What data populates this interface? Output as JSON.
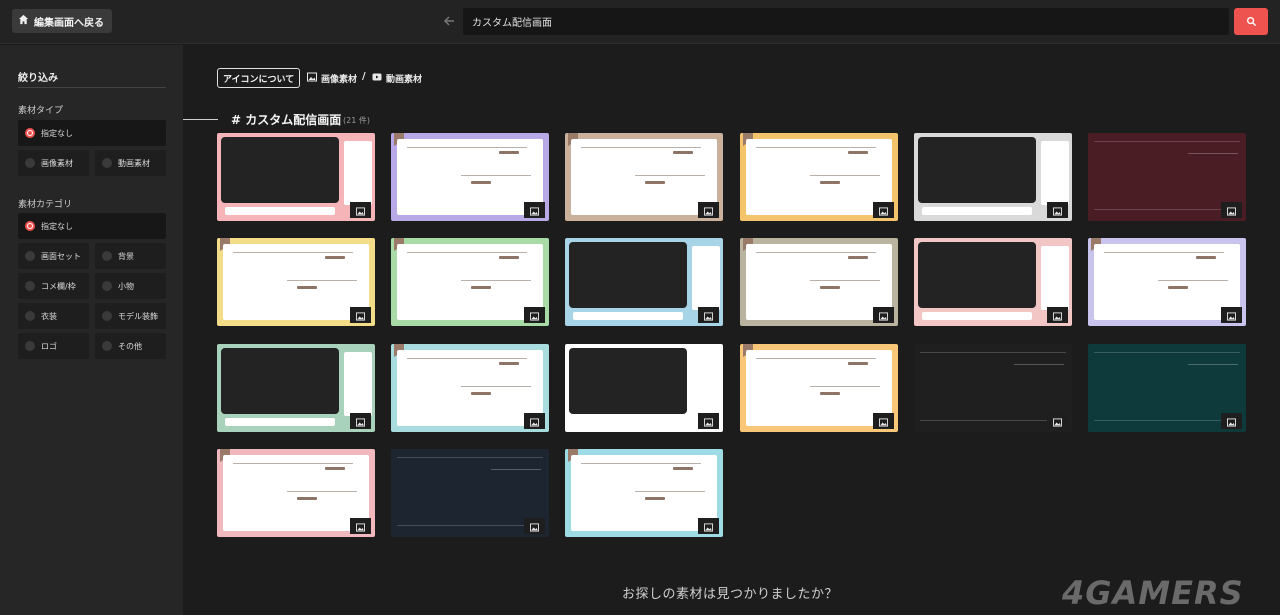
{
  "header": {
    "back_label": "編集画面へ戻る",
    "search_value": "カスタム配信画面",
    "icons": [
      "home-icon",
      "arrow-left-icon",
      "search-icon"
    ],
    "accent": "#ef5350"
  },
  "sidebar": {
    "title": "絞り込み",
    "material_type": {
      "label": "素材タイプ",
      "options": [
        "指定なし",
        "画像素材",
        "動画素材"
      ],
      "selected": "指定なし"
    },
    "material_category": {
      "label": "素材カテゴリ",
      "options": [
        "指定なし",
        "画面セット",
        "背景",
        "コメ欄/枠",
        "小物",
        "衣装",
        "モデル装飾",
        "ロゴ",
        "その他"
      ],
      "selected": "指定なし"
    }
  },
  "main": {
    "about_icons": "アイコンについて",
    "legend_image": "画像素材",
    "legend_sep": "/",
    "legend_video": "動画素材",
    "section_title": "# カスタム配信画面",
    "section_count": "(21 件)",
    "footer_question": "お探しの素材は見つかりましたか？"
  },
  "watermark": "4GAMERS",
  "thumbnails": [
    {
      "bg": "#f4b4b8",
      "kind": "screen"
    },
    {
      "bg": "#b9a8e6",
      "kind": "white"
    },
    {
      "bg": "#c9b19b",
      "kind": "white"
    },
    {
      "bg": "#f3c46c",
      "kind": "white"
    },
    {
      "bg": "#d9d9d9",
      "kind": "screen"
    },
    {
      "bg": "#4a1c24",
      "kind": "dark"
    },
    {
      "bg": "#f4dd88",
      "kind": "white"
    },
    {
      "bg": "#a8dba5",
      "kind": "white"
    },
    {
      "bg": "#a7d4e6",
      "kind": "screen"
    },
    {
      "bg": "#b9b39f",
      "kind": "white"
    },
    {
      "bg": "#f3c6c6",
      "kind": "screen"
    },
    {
      "bg": "#c8c4ee",
      "kind": "white"
    },
    {
      "bg": "#a9d2bd",
      "kind": "screen"
    },
    {
      "bg": "#a9dcdf",
      "kind": "white"
    },
    {
      "bg": "#ffffff",
      "kind": "screen"
    },
    {
      "bg": "#f9c777",
      "kind": "white"
    },
    {
      "bg": "#1f1f1f",
      "kind": "dark"
    },
    {
      "bg": "#0e3a3c",
      "kind": "dark"
    },
    {
      "bg": "#f1b9bd",
      "kind": "white"
    },
    {
      "bg": "#1d2630",
      "kind": "dark"
    },
    {
      "bg": "#9edbe5",
      "kind": "white"
    }
  ]
}
